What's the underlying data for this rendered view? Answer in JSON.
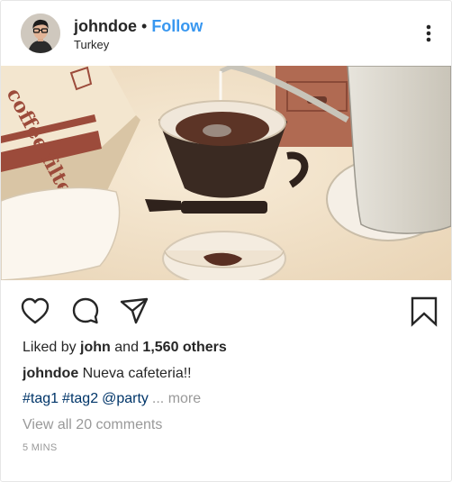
{
  "header": {
    "username": "johndoe",
    "separator": "•",
    "follow_label": "Follow",
    "location": "Turkey"
  },
  "actions": {
    "like_icon": "heart-icon",
    "comment_icon": "comment-icon",
    "share_icon": "send-icon",
    "save_icon": "bookmark-icon"
  },
  "likes": {
    "prefix": "Liked by",
    "first_user": "john",
    "joiner": "and",
    "others": "1,560 others"
  },
  "caption": {
    "username": "johndoe",
    "text": "Nueva cafeteria!!"
  },
  "tags": [
    "#tag1",
    "#tag2",
    "@party"
  ],
  "more_label": "... more",
  "comments_label": "View all 20 comments",
  "time_label": "5 MINS",
  "photo_text": "coffee filter",
  "colors": {
    "follow": "#3897f0",
    "tag": "#003569",
    "muted": "#999999",
    "text": "#262626"
  }
}
